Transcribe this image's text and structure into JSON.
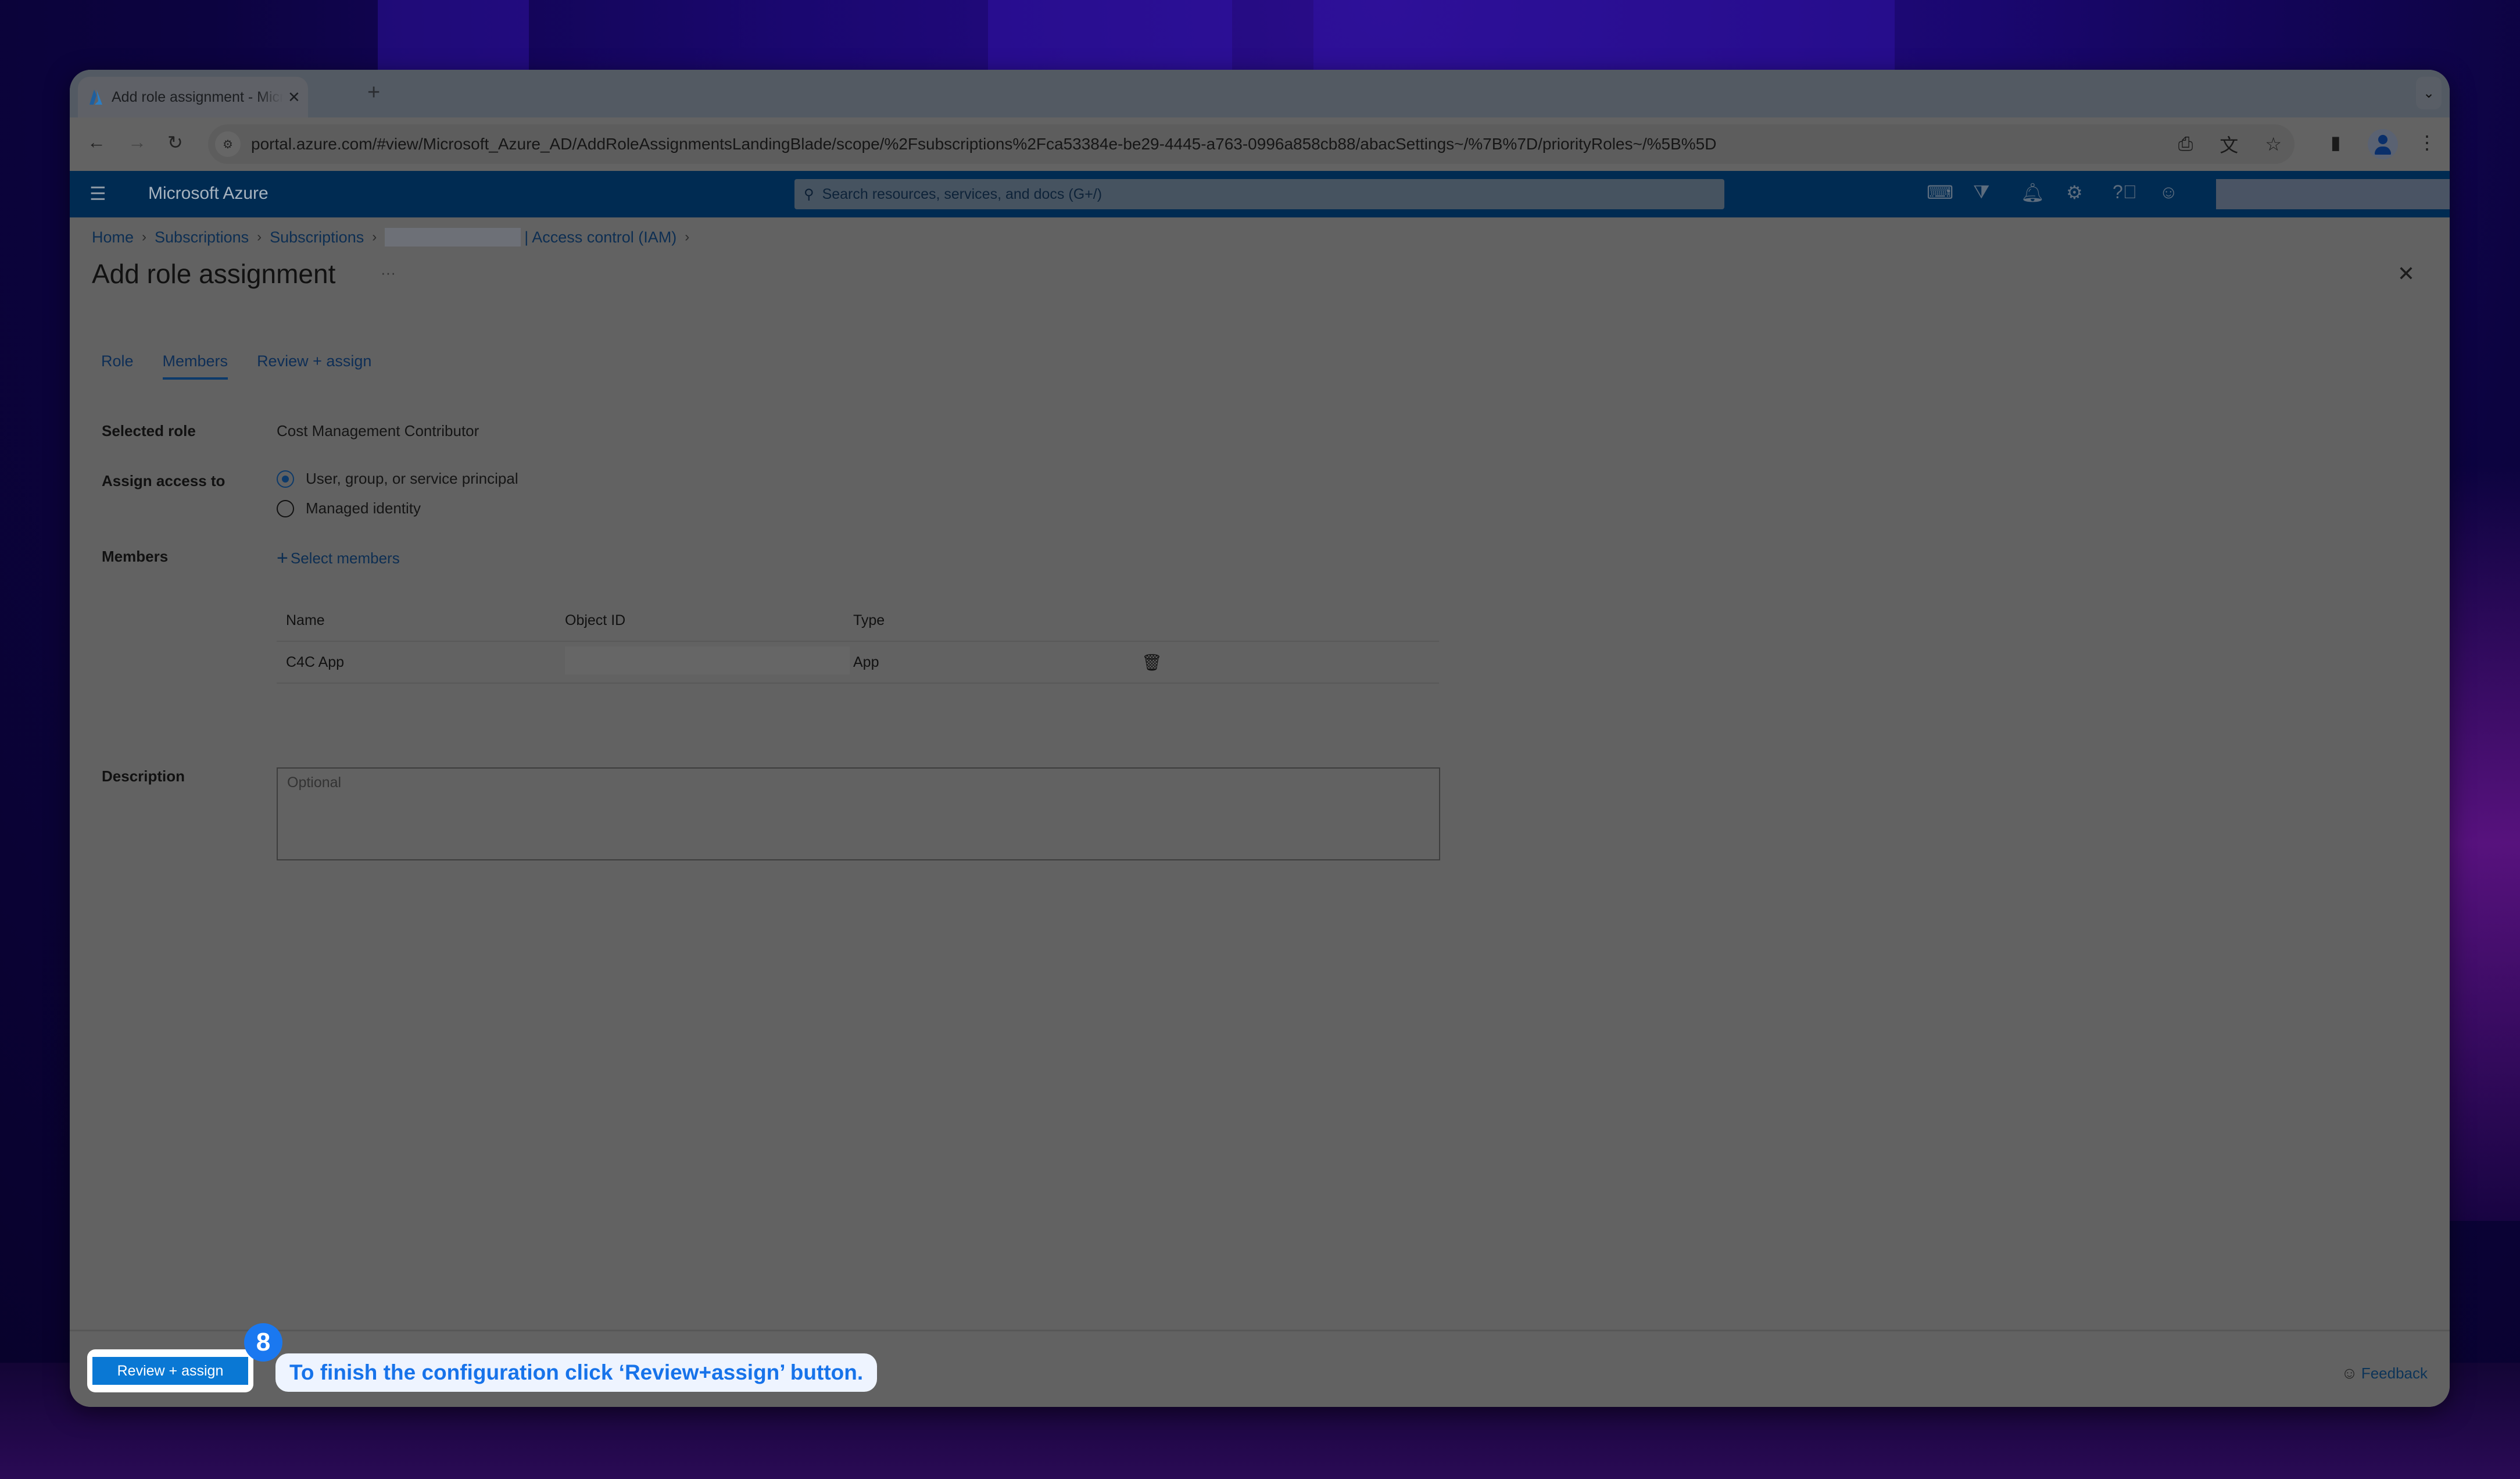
{
  "browser": {
    "tab_title": "Add role assignment - Microsoft Azure",
    "url": "portal.azure.com/#view/Microsoft_Azure_AD/AddRoleAssignmentsLandingBlade/scope/%2Fsubscriptions%2Fca53384e-be29-4445-a763-0996a858cb88/abacSettings~/%7B%7D/priorityRoles~/%5B%5D",
    "icons": [
      "back-icon",
      "forward-icon",
      "reload-icon",
      "site-info-icon",
      "install-app-icon",
      "translate-icon",
      "bookmark-star-icon",
      "side-panel-icon",
      "profile-icon",
      "menu-kebab-icon"
    ]
  },
  "azure_header": {
    "brand": "Microsoft Azure",
    "search_placeholder": "Search resources, services, and docs (G+/)",
    "icons": [
      "cloud-shell-icon",
      "directory-filter-icon",
      "notifications-bell-icon",
      "settings-gear-icon",
      "help-icon",
      "feedback-person-icon"
    ]
  },
  "breadcrumb": [
    {
      "label": "Home"
    },
    {
      "label": "Subscriptions"
    },
    {
      "label": "Subscriptions"
    },
    {
      "label": "| Access control (IAM)"
    }
  ],
  "page": {
    "title": "Add role assignment",
    "more": "···",
    "close": "✕"
  },
  "tabs": [
    {
      "label": "Role",
      "active": false
    },
    {
      "label": "Members",
      "active": true
    },
    {
      "label": "Review + assign",
      "active": false
    }
  ],
  "form": {
    "selected_role_label": "Selected role",
    "selected_role_value": "Cost Management Contributor",
    "assign_access_label": "Assign access to",
    "assign_options": [
      {
        "label": "User, group, or service principal",
        "selected": true
      },
      {
        "label": "Managed identity",
        "selected": false
      }
    ],
    "members_label": "Members",
    "select_members": "Select members",
    "table": {
      "columns": [
        "Name",
        "Object ID",
        "Type"
      ],
      "rows": [
        {
          "name": "C4C App",
          "object_id": "",
          "type": "App"
        }
      ]
    },
    "description_label": "Description",
    "description_placeholder": "Optional",
    "description_value": ""
  },
  "footer": {
    "review_button": "Review + assign",
    "feedback": "Feedback"
  },
  "tutorial": {
    "step": "8",
    "hint": "To finish the configuration click ‘Review+assign’ button.",
    "hint_color": "#1773ea",
    "badge_color": "#1a78f0"
  },
  "colors": {
    "azure_header": "#002b52",
    "primary_button": "#0a78d4",
    "link": "#0d2e52"
  }
}
